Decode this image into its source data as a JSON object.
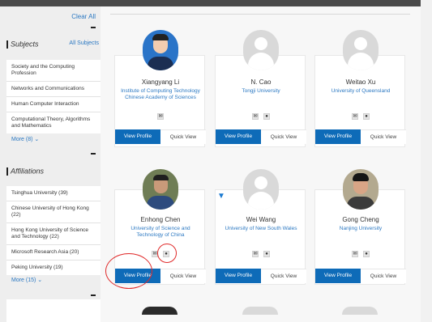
{
  "sidebar": {
    "clear_all": "Clear All",
    "subjects": {
      "heading": "Subjects",
      "all_link": "All Subjects",
      "items": [
        "Society and the Computing Profession",
        "Networks and Communications",
        "Human Computer Interaction",
        "Computational Theory, Algorithms and Mathematics"
      ],
      "more": "More (8)",
      "more_icon": "chevron-down-icon"
    },
    "affiliations": {
      "heading": "Affiliations",
      "items": [
        "Tsinghua University (39)",
        "Chinese University of Hong Kong (22)",
        "Hong Kong University of Science and Technology (22)",
        "Microsoft Research Asia (20)",
        "Peking University (19)"
      ],
      "more": "More (15)",
      "more_icon": "chevron-down-icon"
    }
  },
  "cards": [
    {
      "name": "Xiangyang Li",
      "affiliation": "Institute of Computing Technology Chinese Academy of Sciences",
      "view": "View Profile",
      "quick": "Quick View",
      "icons": [
        "email-icon"
      ]
    },
    {
      "name": "N. Cao",
      "affiliation": "Tongji University",
      "view": "View Profile",
      "quick": "Quick View",
      "icons": [
        "email-icon",
        "globe-icon"
      ]
    },
    {
      "name": "Weitao Xu",
      "affiliation": "University of Queensland",
      "view": "View Profile",
      "quick": "Quick View",
      "icons": [
        "email-icon",
        "globe-icon"
      ]
    },
    {
      "name": "Enhong Chen",
      "affiliation": "University of Science and Technology of China",
      "view": "View Profile",
      "quick": "Quick View",
      "icons": [
        "email-icon",
        "globe-icon"
      ]
    },
    {
      "name": "Wei Wang",
      "affiliation": "University of New South Wales",
      "view": "View Profile",
      "quick": "Quick View",
      "icons": [
        "email-icon",
        "globe-icon"
      ]
    },
    {
      "name": "Gong Cheng",
      "affiliation": "Nanjing University",
      "view": "View Profile",
      "quick": "Quick View",
      "icons": [
        "email-icon",
        "globe-icon"
      ]
    }
  ],
  "colors": {
    "accent": "#0e6bb8",
    "link": "#2b78c2",
    "highlight": "#e02a2a"
  }
}
